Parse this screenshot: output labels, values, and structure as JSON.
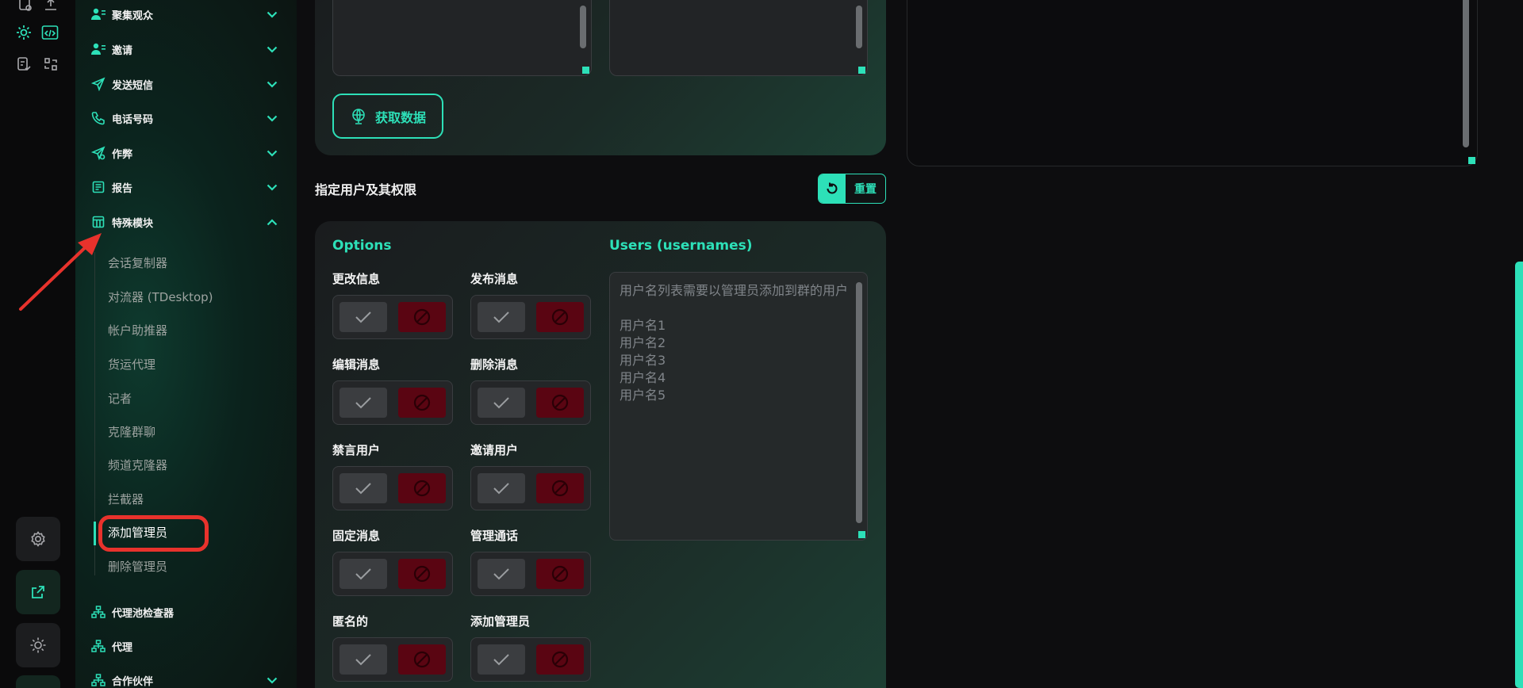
{
  "sidebar": {
    "groups": [
      {
        "label": "聚集观众"
      },
      {
        "label": "邀请"
      },
      {
        "label": "发送短信"
      },
      {
        "label": "电话号码"
      },
      {
        "label": "作弊"
      },
      {
        "label": "报告"
      },
      {
        "label": "特殊模块"
      }
    ],
    "special_items": [
      {
        "label": "会话复制器"
      },
      {
        "label": "对流器 (TDesktop)"
      },
      {
        "label": "帐户助推器"
      },
      {
        "label": "货运代理"
      },
      {
        "label": "记者"
      },
      {
        "label": "克隆群聊"
      },
      {
        "label": "频道克隆器"
      },
      {
        "label": "拦截器"
      },
      {
        "label": "添加管理员"
      },
      {
        "label": "删除管理员"
      }
    ],
    "bottom_groups": [
      {
        "label": "代理池检查器"
      },
      {
        "label": "代理"
      },
      {
        "label": "合作伙伴"
      }
    ]
  },
  "main": {
    "fetch_button": "获取数据",
    "section_title": "指定用户及其权限",
    "reset_button": "重置",
    "options_heading": "Options",
    "users_heading": "Users (usernames)",
    "permissions": [
      {
        "label": "更改信息"
      },
      {
        "label": "发布消息"
      },
      {
        "label": "编辑消息"
      },
      {
        "label": "删除消息"
      },
      {
        "label": "禁言用户"
      },
      {
        "label": "邀请用户"
      },
      {
        "label": "固定消息"
      },
      {
        "label": "管理通话"
      },
      {
        "label": "匿名的"
      },
      {
        "label": "添加管理员"
      }
    ],
    "users_placeholder": "用户名列表需要以管理员添加到群的用户\n\n用户名1\n用户名2\n用户名3\n用户名4\n用户名5"
  },
  "colors": {
    "accent": "#2de0b8",
    "deny": "#5a0512",
    "highlight": "#e8322c"
  }
}
